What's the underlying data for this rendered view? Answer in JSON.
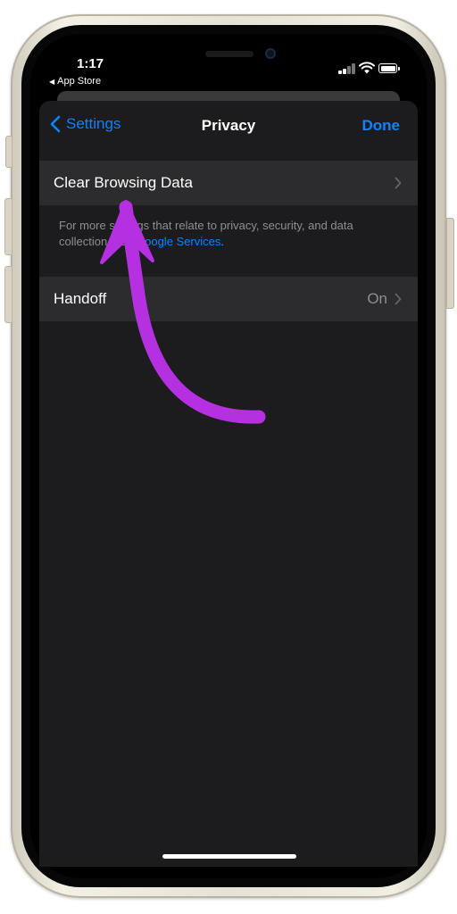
{
  "status_bar": {
    "time": "1:17",
    "back_app": "App Store"
  },
  "navbar": {
    "back_label": "Settings",
    "title": "Privacy",
    "done_label": "Done"
  },
  "rows": {
    "clear_browsing": {
      "label": "Clear Browsing Data"
    },
    "handoff": {
      "label": "Handoff",
      "value": "On"
    }
  },
  "footer_note": {
    "text": "For more settings that relate to privacy, security, and data collection, see ",
    "link": "Google Services",
    "end": "."
  },
  "colors": {
    "accent": "#0a84ff",
    "annotation_arrow": "#b530e0"
  },
  "icons": {
    "back": "chevron-left-icon",
    "row_disclosure": "chevron-right-icon",
    "signal": "cellular-signal-icon",
    "wifi": "wifi-icon",
    "battery": "battery-icon"
  }
}
